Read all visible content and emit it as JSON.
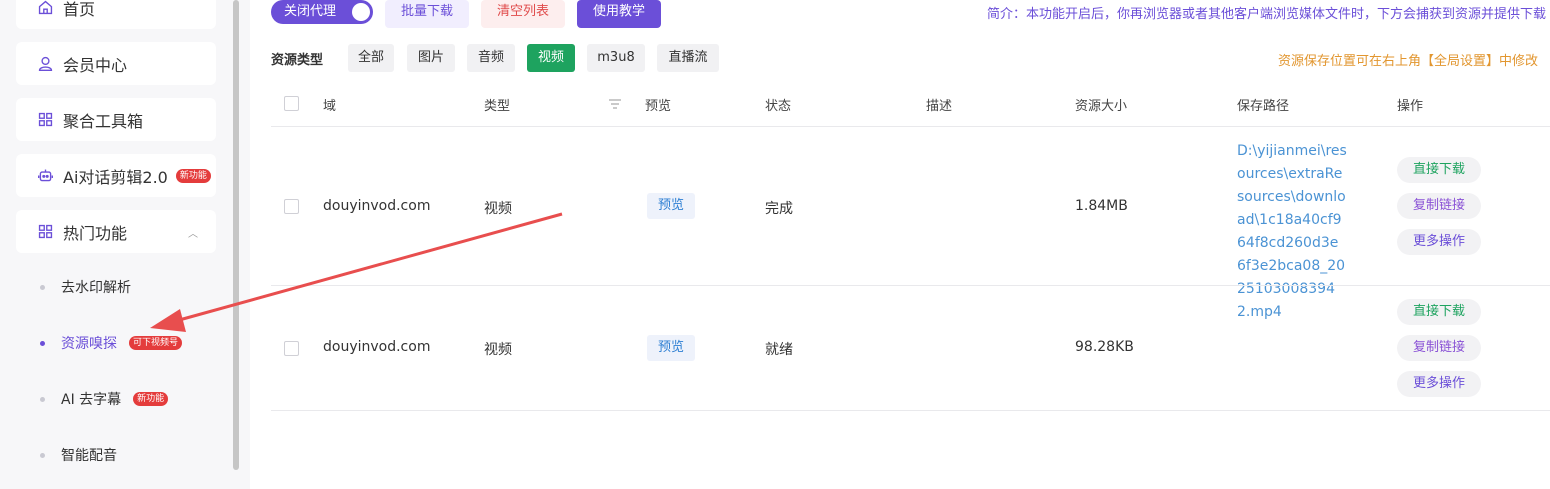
{
  "sidebar": {
    "items": [
      {
        "label": "首页",
        "icon": "home-icon"
      },
      {
        "label": "会员中心",
        "icon": "user-icon"
      },
      {
        "label": "聚合工具箱",
        "icon": "grid-icon"
      },
      {
        "label": "Ai对话剪辑2.0",
        "icon": "robot-icon",
        "badge": "新功能"
      },
      {
        "label": "热门功能",
        "icon": "grid-icon"
      }
    ],
    "sub_items": [
      {
        "label": "去水印解析"
      },
      {
        "label": "资源嗅探",
        "badge": "可下视频号"
      },
      {
        "label": "AI 去字幕",
        "badge": "新功能"
      },
      {
        "label": "智能配音"
      }
    ]
  },
  "toolbar": {
    "toggle_label": "关闭代理",
    "batch_label": "批量下载",
    "clear_label": "清空列表",
    "tutorial_label": "使用教学",
    "intro": "简介：本功能开启后，你再浏览器或者其他客户端浏览媒体文件时，下方会捕获到资源并提供下载"
  },
  "filter": {
    "label": "资源类型",
    "chips": [
      "全部",
      "图片",
      "音频",
      "视频",
      "m3u8",
      "直播流"
    ],
    "active": "视频",
    "save_hint": "资源保存位置可在右上角【全局设置】中修改"
  },
  "table": {
    "headers": [
      "域",
      "类型",
      "预览",
      "状态",
      "描述",
      "资源大小",
      "保存路径",
      "操作"
    ],
    "rows": [
      {
        "domain": "douyinvod.com",
        "type": "视频",
        "preview": "预览",
        "status": "完成",
        "desc": "",
        "size": "1.84MB",
        "path": "D:\\yijianmei\\resources\\extraResources\\download\\1c18a40cf964f8cd260d3e6f3e2bca08_20251030083942.mp4"
      },
      {
        "domain": "douyinvod.com",
        "type": "视频",
        "preview": "预览",
        "status": "就绪",
        "desc": "",
        "size": "98.28KB",
        "path": ""
      }
    ],
    "actions": [
      "直接下载",
      "复制链接",
      "更多操作"
    ]
  },
  "colors": {
    "accent": "#6b4fd8",
    "success": "#1ea35f",
    "danger": "#e04b4b",
    "warning": "#e2962f",
    "link": "#4b93d4",
    "annotation_arrow": "#e84e4e"
  }
}
